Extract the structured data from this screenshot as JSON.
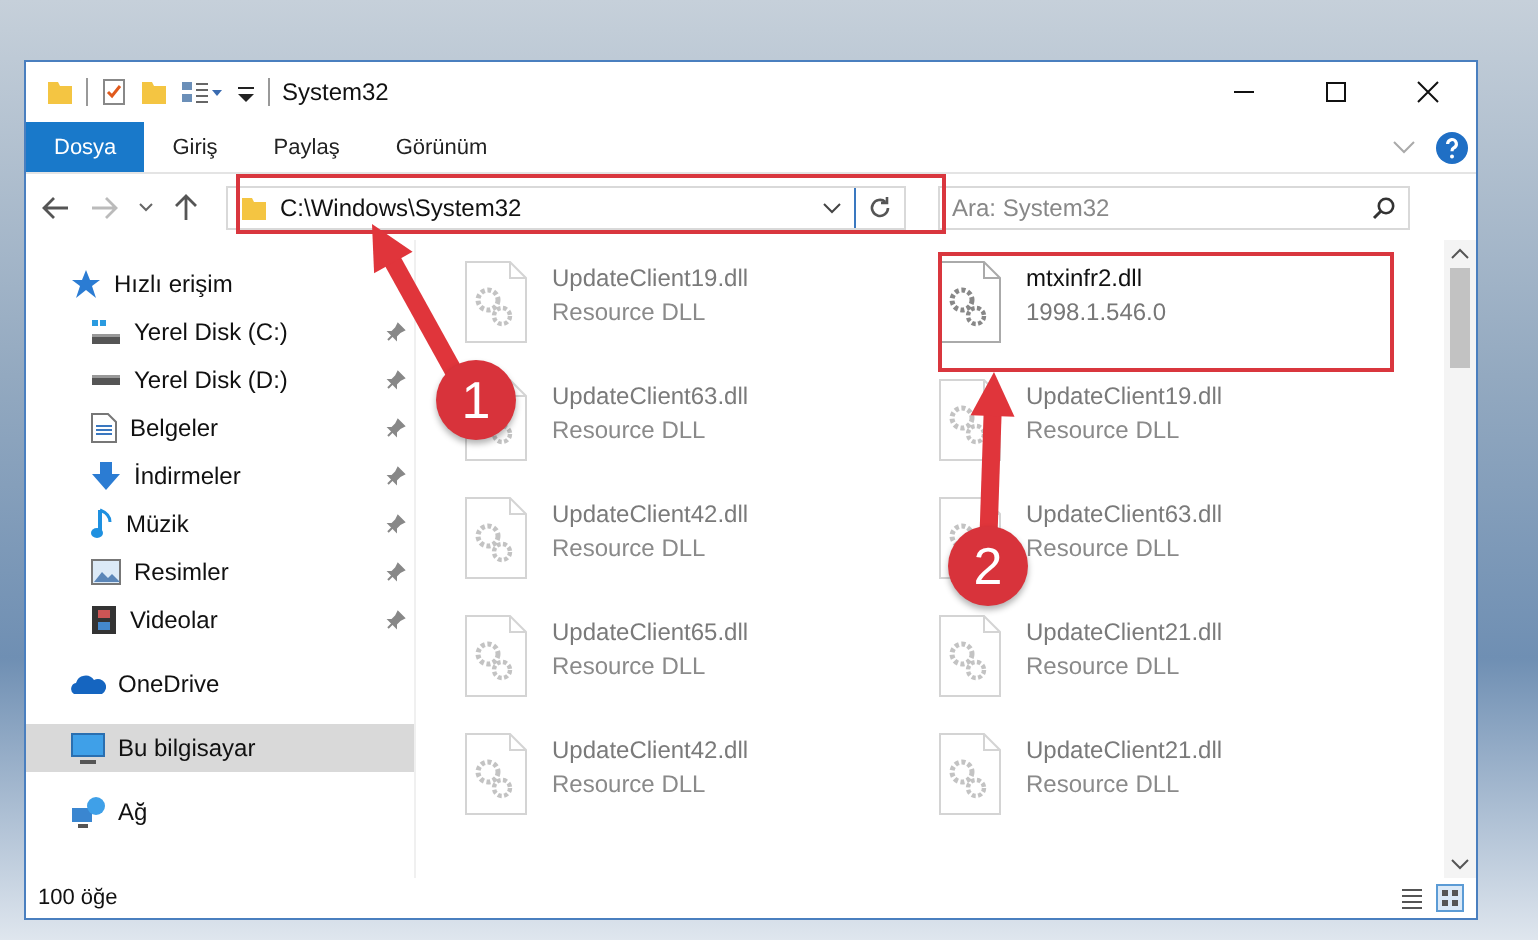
{
  "window": {
    "title": "System32"
  },
  "ribbon_tabs": [
    {
      "label": "Dosya",
      "selected": true
    },
    {
      "label": "Giriş",
      "selected": false
    },
    {
      "label": "Paylaş",
      "selected": false
    },
    {
      "label": "Görünüm",
      "selected": false
    }
  ],
  "address_bar": {
    "value": "C:\\Windows\\System32"
  },
  "search": {
    "placeholder": "Ara: System32"
  },
  "sidebar": {
    "items": [
      {
        "label": "Hızlı erişim",
        "kind": "star",
        "selected": false,
        "children": [
          {
            "label": "Yerel Disk (C:)",
            "kind": "drive-c",
            "pinned": true,
            "selected": false
          },
          {
            "label": "Yerel Disk (D:)",
            "kind": "drive",
            "pinned": true,
            "selected": false
          },
          {
            "label": "Belgeler",
            "kind": "document",
            "pinned": true,
            "selected": false
          },
          {
            "label": "İndirmeler",
            "kind": "download",
            "pinned": true,
            "selected": false
          },
          {
            "label": "Müzik",
            "kind": "music",
            "pinned": true,
            "selected": false
          },
          {
            "label": "Resimler",
            "kind": "image",
            "pinned": true,
            "selected": false
          },
          {
            "label": "Videolar",
            "kind": "video",
            "pinned": true,
            "selected": false
          }
        ]
      },
      {
        "label": "OneDrive",
        "kind": "cloud",
        "selected": false
      },
      {
        "label": "Bu bilgisayar",
        "kind": "computer",
        "selected": true
      },
      {
        "label": "Ağ",
        "kind": "network",
        "selected": false
      }
    ]
  },
  "files": [
    {
      "name": "UpdateClient19.dll",
      "detail": "Resource DLL",
      "blurred": true
    },
    {
      "name": "mtxinfr2.dll",
      "detail": "1998.1.546.0",
      "blurred": false
    },
    {
      "name": "UpdateClient63.dll",
      "detail": "Resource DLL",
      "blurred": true
    },
    {
      "name": "UpdateClient19.dll",
      "detail": "Resource DLL",
      "blurred": true
    },
    {
      "name": "UpdateClient42.dll",
      "detail": "Resource DLL",
      "blurred": true
    },
    {
      "name": "UpdateClient63.dll",
      "detail": "Resource DLL",
      "blurred": true
    },
    {
      "name": "UpdateClient65.dll",
      "detail": "Resource DLL",
      "blurred": true
    },
    {
      "name": "UpdateClient21.dll",
      "detail": "Resource DLL",
      "blurred": true
    },
    {
      "name": "UpdateClient42.dll",
      "detail": "Resource DLL",
      "blurred": true
    },
    {
      "name": "UpdateClient21.dll",
      "detail": "Resource DLL",
      "blurred": true
    }
  ],
  "status_bar": {
    "item_count": "100 öğe"
  },
  "annotations": [
    {
      "label": "1"
    },
    {
      "label": "2"
    }
  ]
}
